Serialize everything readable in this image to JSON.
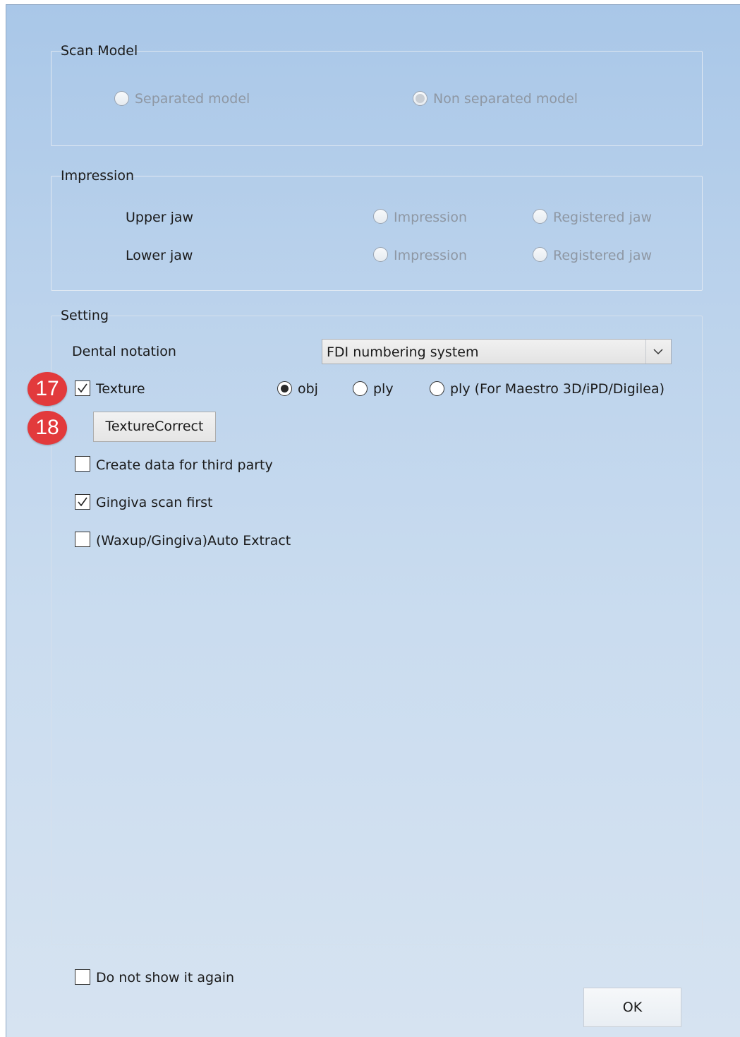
{
  "scan_model": {
    "title": "Scan Model",
    "options": [
      {
        "label": "Separated model",
        "selected": false,
        "enabled": false
      },
      {
        "label": "Non separated model",
        "selected": true,
        "enabled": false
      }
    ]
  },
  "impression": {
    "title": "Impression",
    "rows": [
      {
        "label": "Upper jaw",
        "option1": "Impression",
        "option2": "Registered jaw"
      },
      {
        "label": "Lower jaw",
        "option1": "Impression",
        "option2": "Registered jaw"
      }
    ]
  },
  "setting": {
    "title": "Setting",
    "dental_notation_label": "Dental notation",
    "dental_notation_value": "FDI numbering system",
    "texture_label": "Texture",
    "texture_checked": true,
    "format_options": [
      {
        "label": "obj",
        "selected": true
      },
      {
        "label": "ply",
        "selected": false
      },
      {
        "label": "ply (For Maestro 3D/iPD/Digilea)",
        "selected": false
      }
    ],
    "texture_correct_button": "TextureCorrect",
    "create_third_party_label": "Create data for third party",
    "create_third_party_checked": false,
    "gingiva_scan_first_label": "Gingiva scan first",
    "gingiva_scan_first_checked": true,
    "auto_extract_label": "(Waxup/Gingiva)Auto Extract",
    "auto_extract_checked": false
  },
  "badges": {
    "b17": "17",
    "b18": "18",
    "color": "#e23a3c"
  },
  "footer": {
    "do_not_show_label": "Do not show it again",
    "do_not_show_checked": false,
    "ok_button": "OK"
  }
}
